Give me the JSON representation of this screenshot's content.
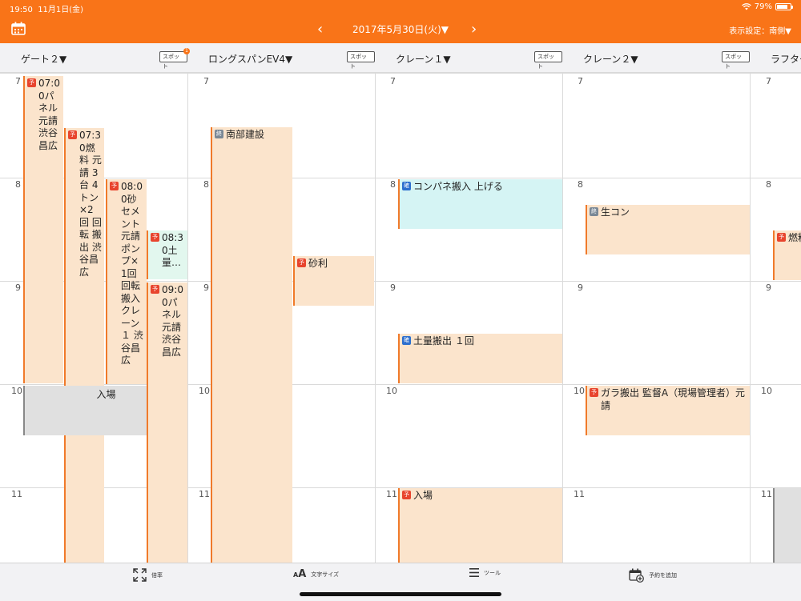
{
  "status": {
    "time": "19:50",
    "date": "11月1日(金)",
    "battery": "79%"
  },
  "header": {
    "date_title": "2017年5月30日(火)▼",
    "prev": "‹",
    "next": "›",
    "display_setting": "表示設定：南側▼"
  },
  "columns": [
    {
      "name": "ゲート２▼",
      "spot": "スポット",
      "badge": "1"
    },
    {
      "name": "ロングスパンEV4▼",
      "spot": "スポット"
    },
    {
      "name": "クレーン１▼",
      "spot": "スポット"
    },
    {
      "name": "クレーン２▼",
      "spot": "スポット"
    },
    {
      "name": "ラフター",
      "spot": ""
    }
  ],
  "hours": [
    "7",
    "8",
    "9",
    "10",
    "11"
  ],
  "badges": {
    "yo": "予",
    "shu": "終",
    "kaku": "確"
  },
  "colors": {
    "accent": "#f97418",
    "yo": "#e8442d",
    "shu": "#7a8896",
    "kaku": "#2d6fce"
  },
  "events": [
    {
      "text": "07:00パネル元請 渋谷昌広",
      "badge": "yo"
    },
    {
      "text": "07:30燃料 元請 3台 4トン×2回 回転 搬出 渋谷昌広",
      "badge": "yo"
    },
    {
      "text": "08:00砂セメント 元請ポンプ×1回 回転搬入 クレーン１ 渋谷昌広",
      "badge": "yo"
    },
    {
      "text": "08:30土量…",
      "badge": "yo"
    },
    {
      "text": "09:00パネル元請 渋谷昌広",
      "badge": "yo"
    },
    {
      "text": "入場",
      "badge": ""
    },
    {
      "text": "南部建設",
      "badge": "shu"
    },
    {
      "text": "砂利",
      "badge": "yo"
    },
    {
      "text": "コンパネ搬入 上げる",
      "badge": "kaku"
    },
    {
      "text": "土量搬出 １回",
      "badge": "kaku"
    },
    {
      "text": "入場",
      "badge": "yo"
    },
    {
      "text": "生コン",
      "badge": "shu"
    },
    {
      "text": "ガラ搬出 監督A（現場管理者）元請",
      "badge": "yo"
    },
    {
      "text": "燃料",
      "badge": "yo"
    },
    {
      "text": "",
      "badge": ""
    }
  ],
  "footer": {
    "zoom": "倍率",
    "font_size": "文字サイズ",
    "tools": "ツール",
    "add_reservation": "予約を追加"
  }
}
